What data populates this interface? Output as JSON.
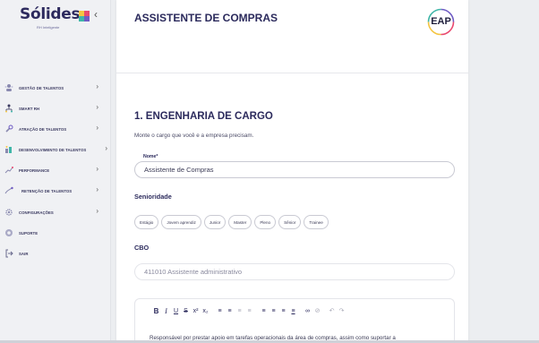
{
  "brand": {
    "name": "Sólides",
    "subtitle": "RH Inteligente",
    "colors": [
      "#f4c542",
      "#e94a6f",
      "#3fb6a8",
      "#6f5cc4"
    ]
  },
  "sidebar": {
    "collapse_icon": "chevron-left-icon",
    "items": [
      {
        "label": "GESTÃO DE TALENTOS",
        "icon": "people-icon",
        "has_chevron": true
      },
      {
        "label": "SMART RH",
        "icon": "org-chart-icon",
        "has_chevron": true
      },
      {
        "label": "ATRAÇÃO DE TALENTOS",
        "icon": "magnet-icon",
        "has_chevron": true
      },
      {
        "label": "DESENVOLVIMENTO DE TALENTOS",
        "icon": "growth-icon",
        "has_chevron": true
      },
      {
        "label": "PERFORMANCE",
        "icon": "performance-icon",
        "has_chevron": true
      },
      {
        "label": "RETENÇÃO DE TALENTOS",
        "icon": "retention-icon",
        "has_chevron": true
      },
      {
        "label": "CONFIGURAÇÕES",
        "icon": "gear-icon",
        "has_chevron": true
      },
      {
        "label": "SUPORTE",
        "icon": "support-icon",
        "has_chevron": false
      },
      {
        "label": "SAIR",
        "icon": "logout-icon",
        "has_chevron": false
      }
    ]
  },
  "header": {
    "title": "ASSISTENTE DE COMPRAS",
    "badge": "EAP"
  },
  "section": {
    "title": "1. ENGENHARIA DE CARGO",
    "description": "Monte o cargo que você e a empresa precisam."
  },
  "form": {
    "nome_label": "Nome*",
    "nome_value": "Assistente de Compras",
    "senioridade_label": "Senioridade",
    "senioridade_options": [
      "Estágio",
      "Jovem aprendiz",
      "Junior",
      "Master",
      "Pleno",
      "Sênior",
      "Trainee"
    ],
    "cbo_label": "CBO",
    "cbo_value": "411010 Assistente administrativo"
  },
  "editor": {
    "toolbar": [
      "bold-icon",
      "italic-icon",
      "underline-icon",
      "strikethrough-icon",
      "superscript-icon",
      "subscript-icon",
      "bullet-list-icon",
      "numbered-list-icon",
      "indent-icon",
      "outdent-icon",
      "align-left-icon",
      "align-center-icon",
      "align-right-icon",
      "align-justify-icon",
      "link-icon",
      "unlink-icon",
      "undo-icon",
      "redo-icon"
    ],
    "content": "Responsável por prestar apoio em tarefas operacionais da área de compras, assim como suportar a"
  }
}
